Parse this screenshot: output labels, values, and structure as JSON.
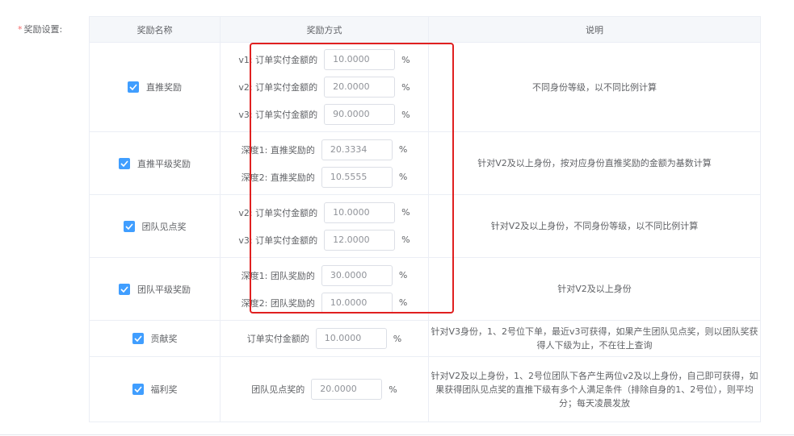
{
  "form_label": "奖励设置:",
  "required_mark": "*",
  "headers": {
    "name": "奖励名称",
    "method": "奖励方式",
    "desc": "说明"
  },
  "rows": [
    {
      "name": "直推奖励",
      "checked": true,
      "methods": [
        {
          "label": "v1:  订单实付金额的",
          "value": "10.0000",
          "unit": "%"
        },
        {
          "label": "v2:  订单实付金额的",
          "value": "20.0000",
          "unit": "%"
        },
        {
          "label": "v3:  订单实付金额的",
          "value": "90.0000",
          "unit": "%"
        }
      ],
      "desc": "不同身份等级，以不同比例计算"
    },
    {
      "name": "直推平级奖励",
      "checked": true,
      "methods": [
        {
          "label": "深度1:  直推奖励的",
          "value": "20.3334",
          "unit": "%"
        },
        {
          "label": "深度2:  直推奖励的",
          "value": "10.5555",
          "unit": "%"
        }
      ],
      "desc": "针对V2及以上身份，按对应身份直推奖励的金额为基数计算"
    },
    {
      "name": "团队见点奖",
      "checked": true,
      "methods": [
        {
          "label": "v2:  订单实付金额的",
          "value": "10.0000",
          "unit": "%"
        },
        {
          "label": "v3:  订单实付金额的",
          "value": "12.0000",
          "unit": "%"
        }
      ],
      "desc": "针对V2及以上身份，不同身份等级，以不同比例计算"
    },
    {
      "name": "团队平级奖励",
      "checked": true,
      "methods": [
        {
          "label": "深度1:  团队奖励的",
          "value": "30.0000",
          "unit": "%"
        },
        {
          "label": "深度2:  团队奖励的",
          "value": "10.0000",
          "unit": "%"
        }
      ],
      "desc": "针对V2及以上身份"
    },
    {
      "name": "贡献奖",
      "checked": true,
      "methods": [
        {
          "label": "订单实付金额的",
          "value": "10.0000",
          "unit": "%"
        }
      ],
      "desc": "针对V3身份，1、2号位下单，最近v3可获得，如果产生团队见点奖，则以团队奖获得人下级为止，不在往上查询"
    },
    {
      "name": "福利奖",
      "checked": true,
      "methods": [
        {
          "label": "团队见点奖的",
          "value": "20.0000",
          "unit": "%"
        }
      ],
      "desc": "针对V2及以上身份，1、2号位团队下各产生两位v2及以上身份，自己即可获得，如果获得团队见点奖的直推下级有多个人满足条件（排除自身的1、2号位），则平均分；每天凌晨发放"
    }
  ],
  "colors": {
    "accent": "#409eff",
    "highlight": "#e02020",
    "required": "#f56c6c"
  }
}
